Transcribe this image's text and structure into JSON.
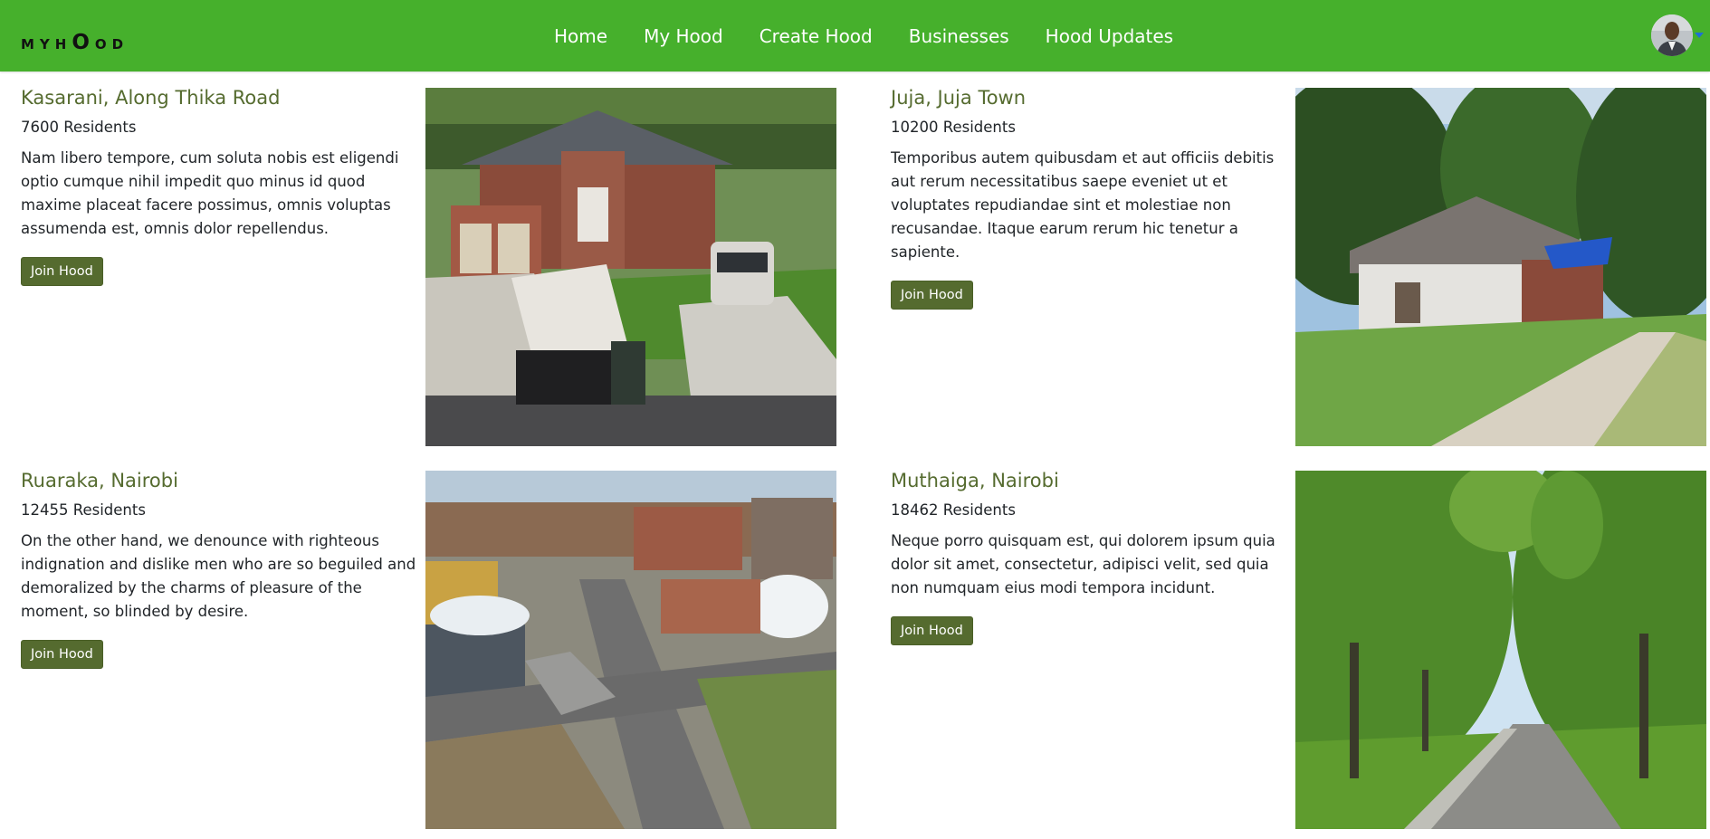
{
  "brand": {
    "prefix": "MYH",
    "mid": "O",
    "suffix": "OD"
  },
  "nav": {
    "links": [
      "Home",
      "My Hood",
      "Create Hood",
      "Businesses",
      "Hood Updates"
    ]
  },
  "hoods": [
    {
      "name": "Kasarani, Along Thika Road",
      "residents": "7600 Residents",
      "description": "Nam libero tempore, cum soluta nobis est eligendi optio cumque nihil impedit quo minus id quod maxime placeat facere possimus, omnis voluptas assumenda est, omnis dolor repellendus.",
      "button": "Join Hood",
      "image": "suburban-brick-house-driveway-photo"
    },
    {
      "name": "Juja, Juja Town",
      "residents": "10200 Residents",
      "description": "Temporibus autem quibusdam et aut officiis debitis aut rerum necessitatibus saepe eveniet ut et voluptates repudiandae sint et molestiae non recusandae. Itaque earum rerum hic tenetur a sapiente.",
      "button": "Join Hood",
      "image": "abandoned-white-house-road-photo"
    },
    {
      "name": "Ruaraka, Nairobi",
      "residents": "12455 Residents",
      "description": "On the other hand, we denounce with righteous indignation and dislike men who are so beguiled and demoralized by the charms of pleasure of the moment, so blinded by desire.",
      "button": "Join Hood",
      "image": "aerial-city-intersection-photo"
    },
    {
      "name": "Muthaiga, Nairobi",
      "residents": "18462 Residents",
      "description": "Neque porro quisquam est, qui dolorem ipsum quia dolor sit amet, consectetur, adipisci velit, sed quia non numquam eius modi tempora incidunt.",
      "button": "Join Hood",
      "image": "tree-lined-street-photo"
    }
  ]
}
